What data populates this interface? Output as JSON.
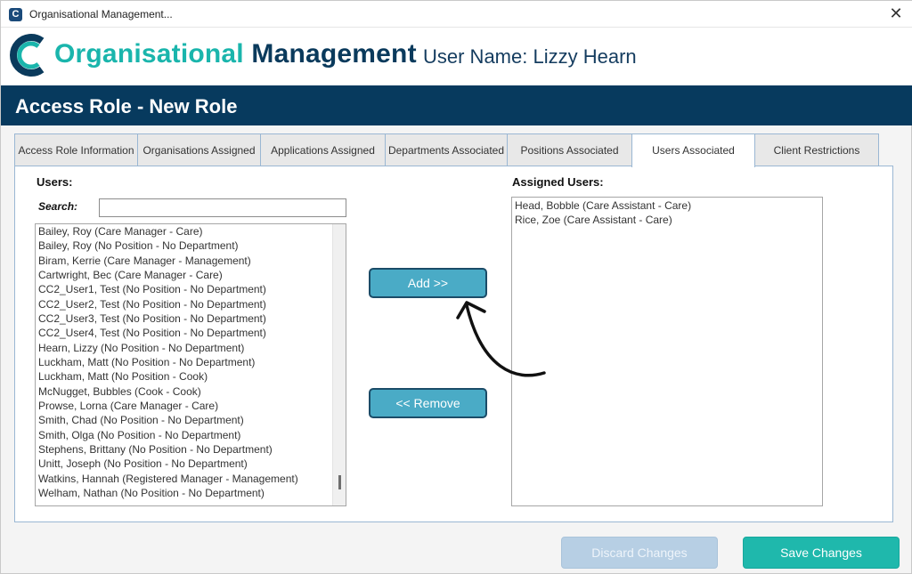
{
  "window": {
    "title": "Organisational Management...",
    "icon": "app-logo-icon",
    "close_symbol": "✕"
  },
  "header": {
    "brand_part1": "Organisational",
    "brand_part2": "Management",
    "username": "User Name: Lizzy Hearn",
    "colors": {
      "teal": "#1ab5ac",
      "navy": "#0a3a5c"
    }
  },
  "role_bar": {
    "title": "Access Role - New Role",
    "color": "#073a5e"
  },
  "tabs": [
    {
      "label": "Access Role Information",
      "active": false
    },
    {
      "label": "Organisations Assigned",
      "active": false
    },
    {
      "label": "Applications Assigned",
      "active": false
    },
    {
      "label": "Departments Associated",
      "active": false
    },
    {
      "label": "Positions Associated",
      "active": false
    },
    {
      "label": "Users Associated",
      "active": true
    },
    {
      "label": "Client Restrictions",
      "active": false
    }
  ],
  "users_panel": {
    "label": "Users:",
    "search_label": "Search:",
    "search_value": "",
    "items": [
      "Bailey, Roy (Care Manager - Care)",
      "Bailey, Roy (No Position - No Department)",
      "Biram, Kerrie (Care Manager - Management)",
      "Cartwright, Bec (Care Manager - Care)",
      "CC2_User1, Test (No Position - No Department)",
      "CC2_User2, Test (No Position - No Department)",
      "CC2_User3, Test (No Position - No Department)",
      "CC2_User4, Test (No Position - No Department)",
      "Hearn, Lizzy (No Position - No Department)",
      "Luckham, Matt (No Position - No Department)",
      "Luckham, Matt (No Position - Cook)",
      "McNugget, Bubbles (Cook - Cook)",
      "Prowse, Lorna (Care Manager - Care)",
      "Smith, Chad (No Position - No Department)",
      "Smith, Olga (No Position - No Department)",
      "Stephens, Brittany (No Position - No Department)",
      "Unitt, Joseph (No Position - No Department)",
      "Watkins, Hannah (Registered Manager - Management)",
      "Welham, Nathan (No Position - No Department)"
    ]
  },
  "buttons": {
    "add": "Add  >>",
    "remove": "<< Remove",
    "discard": "Discard Changes",
    "save": "Save Changes",
    "colors": {
      "action": "#4aabc6",
      "save": "#1fb8ac",
      "discard_disabled": "#b7cfe4"
    }
  },
  "assigned_panel": {
    "label": "Assigned Users:",
    "items": [
      "Head, Bobble (Care Assistant - Care)",
      "Rice, Zoe (Care Assistant - Care)"
    ]
  },
  "annotation": {
    "icon": "curved-arrow-icon"
  }
}
